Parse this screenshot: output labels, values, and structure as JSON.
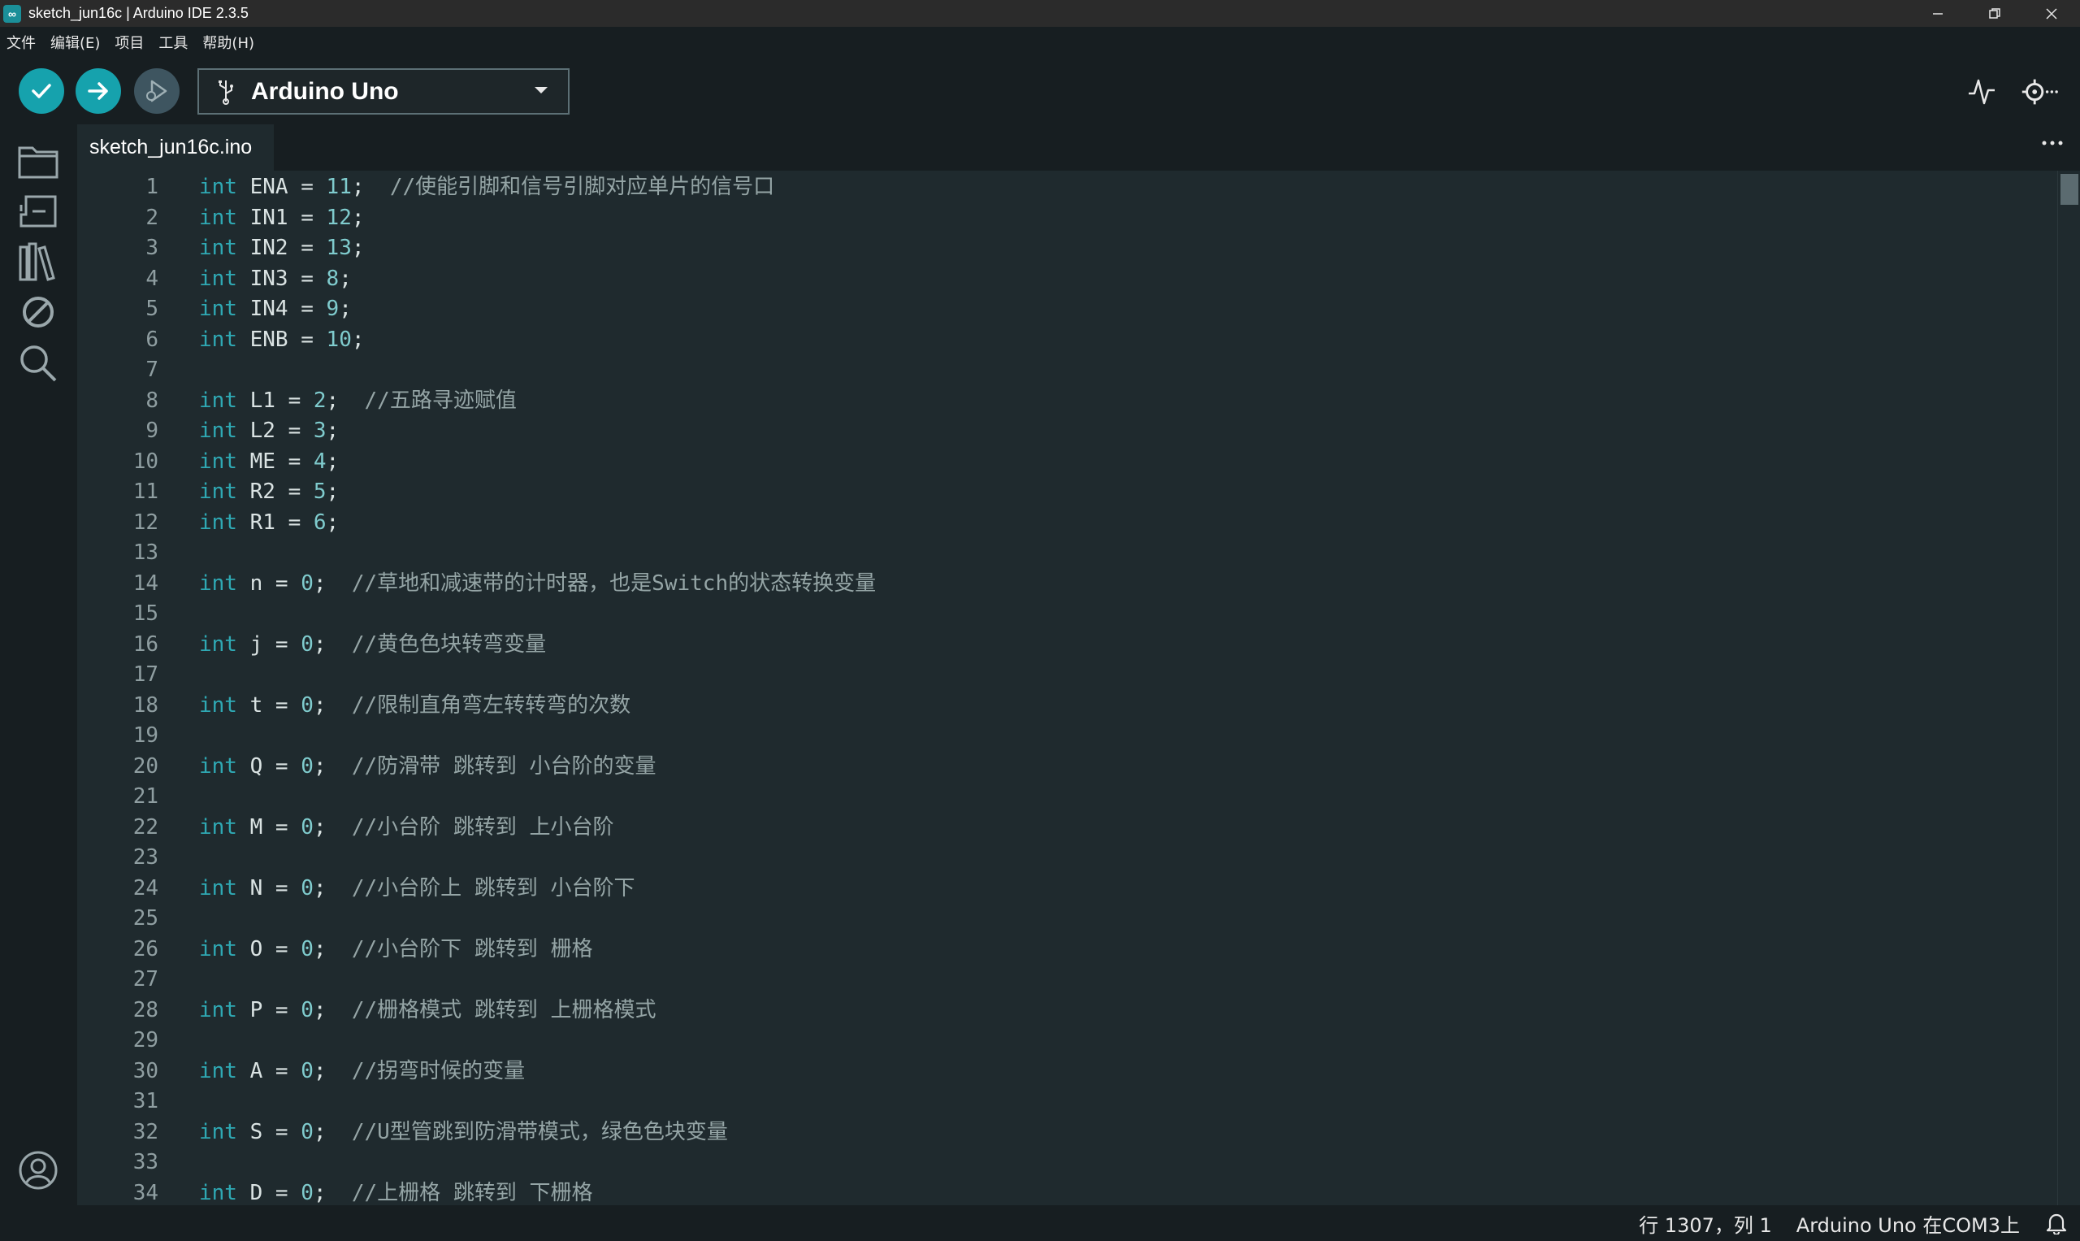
{
  "window": {
    "title": "sketch_jun16c | Arduino IDE 2.3.5"
  },
  "menu": [
    "文件",
    "编辑(E)",
    "项目",
    "工具",
    "帮助(H)"
  ],
  "toolbar": {
    "board": "Arduino Uno"
  },
  "tab": {
    "active": "sketch_jun16c.ino"
  },
  "colors": {
    "accent": "#16a2ad",
    "editor_bg": "#1f2a2e",
    "keyword": "#2fa9b4",
    "number": "#7fcbcd",
    "comment": "#95a5a6"
  },
  "icons": {
    "toolbar": [
      "verify-icon",
      "upload-icon",
      "debug-icon",
      "usb-icon",
      "chevron-down-icon",
      "serial-plotter-icon",
      "serial-monitor-icon"
    ],
    "sidebar": [
      "sketchbook-folder-icon",
      "boards-manager-icon",
      "library-manager-icon",
      "debug-sidebar-icon",
      "search-icon",
      "account-icon"
    ],
    "status": [
      "bell-icon"
    ]
  },
  "code_lines": [
    {
      "n": "1",
      "kw": "int",
      "text": " ENA = ",
      "num": "11",
      "end": ";",
      "comment": "  //使能引脚和信号引脚对应单片的信号口"
    },
    {
      "n": "2",
      "kw": "int",
      "text": " IN1 = ",
      "num": "12",
      "end": ";",
      "comment": ""
    },
    {
      "n": "3",
      "kw": "int",
      "text": " IN2 = ",
      "num": "13",
      "end": ";",
      "comment": ""
    },
    {
      "n": "4",
      "kw": "int",
      "text": " IN3 = ",
      "num": "8",
      "end": ";",
      "comment": ""
    },
    {
      "n": "5",
      "kw": "int",
      "text": " IN4 = ",
      "num": "9",
      "end": ";",
      "comment": ""
    },
    {
      "n": "6",
      "kw": "int",
      "text": " ENB = ",
      "num": "10",
      "end": ";",
      "comment": ""
    },
    {
      "n": "7",
      "kw": "",
      "text": "",
      "num": "",
      "end": "",
      "comment": ""
    },
    {
      "n": "8",
      "kw": "int",
      "text": " L1 = ",
      "num": "2",
      "end": ";",
      "comment": "  //五路寻迹赋值"
    },
    {
      "n": "9",
      "kw": "int",
      "text": " L2 = ",
      "num": "3",
      "end": ";",
      "comment": ""
    },
    {
      "n": "10",
      "kw": "int",
      "text": " ME = ",
      "num": "4",
      "end": ";",
      "comment": ""
    },
    {
      "n": "11",
      "kw": "int",
      "text": " R2 = ",
      "num": "5",
      "end": ";",
      "comment": ""
    },
    {
      "n": "12",
      "kw": "int",
      "text": " R1 = ",
      "num": "6",
      "end": ";",
      "comment": ""
    },
    {
      "n": "13",
      "kw": "",
      "text": "",
      "num": "",
      "end": "",
      "comment": ""
    },
    {
      "n": "14",
      "kw": "int",
      "text": " n = ",
      "num": "0",
      "end": ";",
      "comment": "  //草地和减速带的计时器，也是Switch的状态转换变量"
    },
    {
      "n": "15",
      "kw": "",
      "text": "",
      "num": "",
      "end": "",
      "comment": ""
    },
    {
      "n": "16",
      "kw": "int",
      "text": " j = ",
      "num": "0",
      "end": ";",
      "comment": "  //黄色色块转弯变量"
    },
    {
      "n": "17",
      "kw": "",
      "text": "",
      "num": "",
      "end": "",
      "comment": ""
    },
    {
      "n": "18",
      "kw": "int",
      "text": " t = ",
      "num": "0",
      "end": ";",
      "comment": "  //限制直角弯左转转弯的次数"
    },
    {
      "n": "19",
      "kw": "",
      "text": "",
      "num": "",
      "end": "",
      "comment": ""
    },
    {
      "n": "20",
      "kw": "int",
      "text": " Q = ",
      "num": "0",
      "end": ";",
      "comment": "  //防滑带 跳转到 小台阶的变量"
    },
    {
      "n": "21",
      "kw": "",
      "text": "",
      "num": "",
      "end": "",
      "comment": ""
    },
    {
      "n": "22",
      "kw": "int",
      "text": " M = ",
      "num": "0",
      "end": ";",
      "comment": "  //小台阶 跳转到 上小台阶"
    },
    {
      "n": "23",
      "kw": "",
      "text": "",
      "num": "",
      "end": "",
      "comment": ""
    },
    {
      "n": "24",
      "kw": "int",
      "text": " N = ",
      "num": "0",
      "end": ";",
      "comment": "  //小台阶上 跳转到 小台阶下"
    },
    {
      "n": "25",
      "kw": "",
      "text": "",
      "num": "",
      "end": "",
      "comment": ""
    },
    {
      "n": "26",
      "kw": "int",
      "text": " O = ",
      "num": "0",
      "end": ";",
      "comment": "  //小台阶下 跳转到 栅格"
    },
    {
      "n": "27",
      "kw": "",
      "text": "",
      "num": "",
      "end": "",
      "comment": ""
    },
    {
      "n": "28",
      "kw": "int",
      "text": " P = ",
      "num": "0",
      "end": ";",
      "comment": "  //栅格模式 跳转到 上栅格模式"
    },
    {
      "n": "29",
      "kw": "",
      "text": "",
      "num": "",
      "end": "",
      "comment": ""
    },
    {
      "n": "30",
      "kw": "int",
      "text": " A = ",
      "num": "0",
      "end": ";",
      "comment": "  //拐弯时候的变量"
    },
    {
      "n": "31",
      "kw": "",
      "text": "",
      "num": "",
      "end": "",
      "comment": ""
    },
    {
      "n": "32",
      "kw": "int",
      "text": " S = ",
      "num": "0",
      "end": ";",
      "comment": "  //U型管跳到防滑带模式，绿色色块变量"
    },
    {
      "n": "33",
      "kw": "",
      "text": "",
      "num": "",
      "end": "",
      "comment": ""
    },
    {
      "n": "34",
      "kw": "int",
      "text": " D = ",
      "num": "0",
      "end": ";",
      "comment": "  //上栅格 跳转到 下栅格"
    }
  ],
  "status": {
    "position": "行 1307，列 1",
    "board_port": "Arduino Uno 在COM3上"
  }
}
